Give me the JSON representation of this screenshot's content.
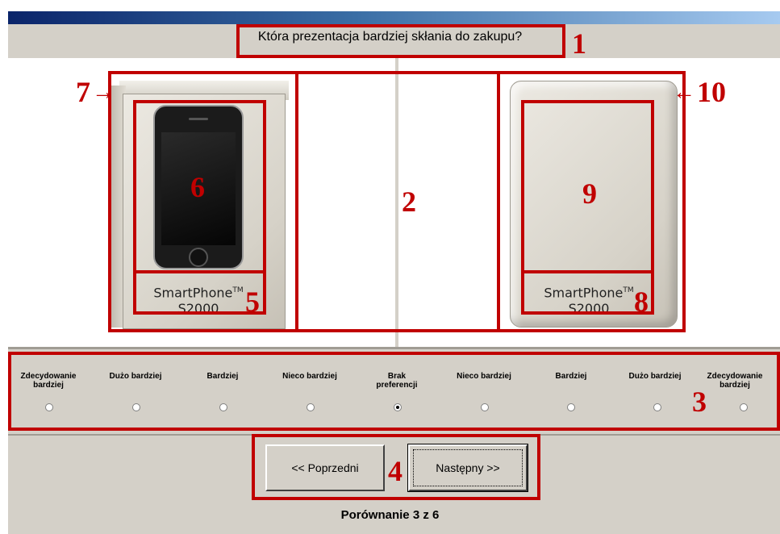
{
  "question": "Która prezentacja bardziej skłania do zakupu?",
  "products": {
    "left": {
      "brand": "SmartPhone",
      "tm": "TM",
      "model": "S2000"
    },
    "right": {
      "brand": "SmartPhone",
      "tm": "TM",
      "model": "S2000"
    }
  },
  "scale_options": [
    {
      "line1": "Zdecydowanie",
      "line2": "bardziej",
      "selected": false
    },
    {
      "line1": "Dużo bardziej",
      "line2": "",
      "selected": false
    },
    {
      "line1": "Bardziej",
      "line2": "",
      "selected": false
    },
    {
      "line1": "Nieco bardziej",
      "line2": "",
      "selected": false
    },
    {
      "line1": "Brak",
      "line2": "preferencji",
      "selected": true
    },
    {
      "line1": "Nieco bardziej",
      "line2": "",
      "selected": false
    },
    {
      "line1": "Bardziej",
      "line2": "",
      "selected": false
    },
    {
      "line1": "Dużo bardziej",
      "line2": "",
      "selected": false
    },
    {
      "line1": "Zdecydowanie",
      "line2": "bardziej",
      "selected": false
    }
  ],
  "buttons": {
    "prev_label": "<< Poprzedni",
    "next_label": "Następny >>"
  },
  "footer": "Porównanie 3 z 6",
  "annotations": {
    "a1": "1",
    "a2": "2",
    "a3": "3",
    "a4": "4",
    "a5": "5",
    "a6": "6",
    "a7": "7",
    "a8": "8",
    "a9": "9",
    "a10": "10",
    "arrow_right": "→",
    "arrow_left": "←"
  },
  "colors": {
    "annotation": "#c00000",
    "dialog": "#d4d0c8"
  }
}
